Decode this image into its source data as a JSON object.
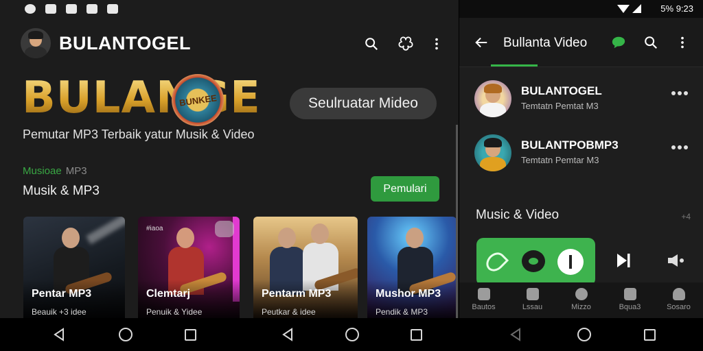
{
  "left_app": {
    "title": "BULANTOGEL",
    "hero_logo_text": "BULANGE",
    "hero_badge_text": "BUNKEE",
    "hero_button": "Seulruatar Mideo",
    "tagline": "Pemutar MP3 Terbaik yatur Musik & Video",
    "section": {
      "label_green": "Musioae",
      "label_gray": "MP3",
      "title": "Musik & MP3",
      "button": "Pemulari"
    },
    "cards": [
      {
        "title": "Pentar MP3",
        "subtitle": "Beauik +3 idee",
        "tag": ""
      },
      {
        "title": "Clemtarj",
        "subtitle": "Penuik & Yidee",
        "tag": "#iaoa"
      },
      {
        "title": "Pentarm MP3",
        "subtitle": "Peutkar & idee",
        "tag": ""
      },
      {
        "title": "Mushor MP3",
        "subtitle": "Pendik & MP3",
        "tag": ""
      }
    ]
  },
  "right_app": {
    "status_text": "5% 9:23",
    "title": "Bullanta Video",
    "chats": [
      {
        "name": "BULANTOGEL",
        "subtitle": "Temtatn Pemtat M3"
      },
      {
        "name": "BULANTPOBMP3",
        "subtitle": "Temtatn Pemtar M3"
      }
    ],
    "section_title": "Music & Video",
    "section_more": "+4",
    "bottom_nav": [
      "Bautos",
      "Lssau",
      "Mizzo",
      "Bqua3",
      "Sosaro"
    ]
  },
  "colors": {
    "accent_green": "#35b548",
    "button_green": "#2f9a3e",
    "bg_dark": "#1c1c1c"
  },
  "icons": [
    "search-icon",
    "share-icon",
    "more-vert-icon",
    "back-arrow-icon",
    "chat-bubble-icon",
    "next-icon",
    "speaker-icon"
  ]
}
